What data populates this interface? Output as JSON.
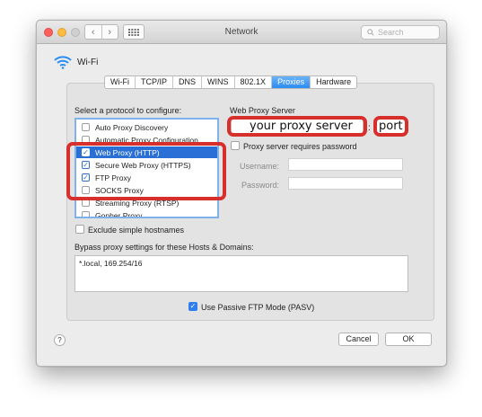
{
  "window": {
    "title": "Network",
    "search_placeholder": "Search",
    "nav_back": "‹",
    "nav_forward": "›"
  },
  "interface": {
    "name": "Wi-Fi"
  },
  "tabs": [
    {
      "label": "Wi-Fi"
    },
    {
      "label": "TCP/IP"
    },
    {
      "label": "DNS"
    },
    {
      "label": "WINS"
    },
    {
      "label": "802.1X"
    },
    {
      "label": "Proxies",
      "active": true
    },
    {
      "label": "Hardware"
    }
  ],
  "protocols": {
    "heading": "Select a protocol to configure:",
    "items": [
      {
        "label": "Auto Proxy Discovery",
        "checked": false
      },
      {
        "label": "Automatic Proxy Configuration",
        "checked": false
      },
      {
        "label": "Web Proxy (HTTP)",
        "checked": true,
        "selected": true
      },
      {
        "label": "Secure Web Proxy (HTTPS)",
        "checked": true
      },
      {
        "label": "FTP Proxy",
        "checked": true
      },
      {
        "label": "SOCKS Proxy",
        "checked": false
      },
      {
        "label": "Streaming Proxy (RTSP)",
        "checked": false
      },
      {
        "label": "Gopher Proxy",
        "checked": false
      }
    ]
  },
  "server": {
    "heading": "Web Proxy Server",
    "host_value": "your proxy server",
    "separator": ":",
    "port_value": "port",
    "requires_password_label": "Proxy server requires password",
    "username_label": "Username:",
    "password_label": "Password:"
  },
  "exclude_simple_label": "Exclude simple hostnames",
  "bypass": {
    "label": "Bypass proxy settings for these Hosts & Domains:",
    "value": "*.local, 169.254/16"
  },
  "passive_ftp_label": "Use Passive FTP Mode (PASV)",
  "buttons": {
    "help": "?",
    "cancel": "Cancel",
    "ok": "OK"
  },
  "colors": {
    "annotation": "#d7302c",
    "selection": "#2a6fd6",
    "active_tab": "#2a8bf2"
  }
}
